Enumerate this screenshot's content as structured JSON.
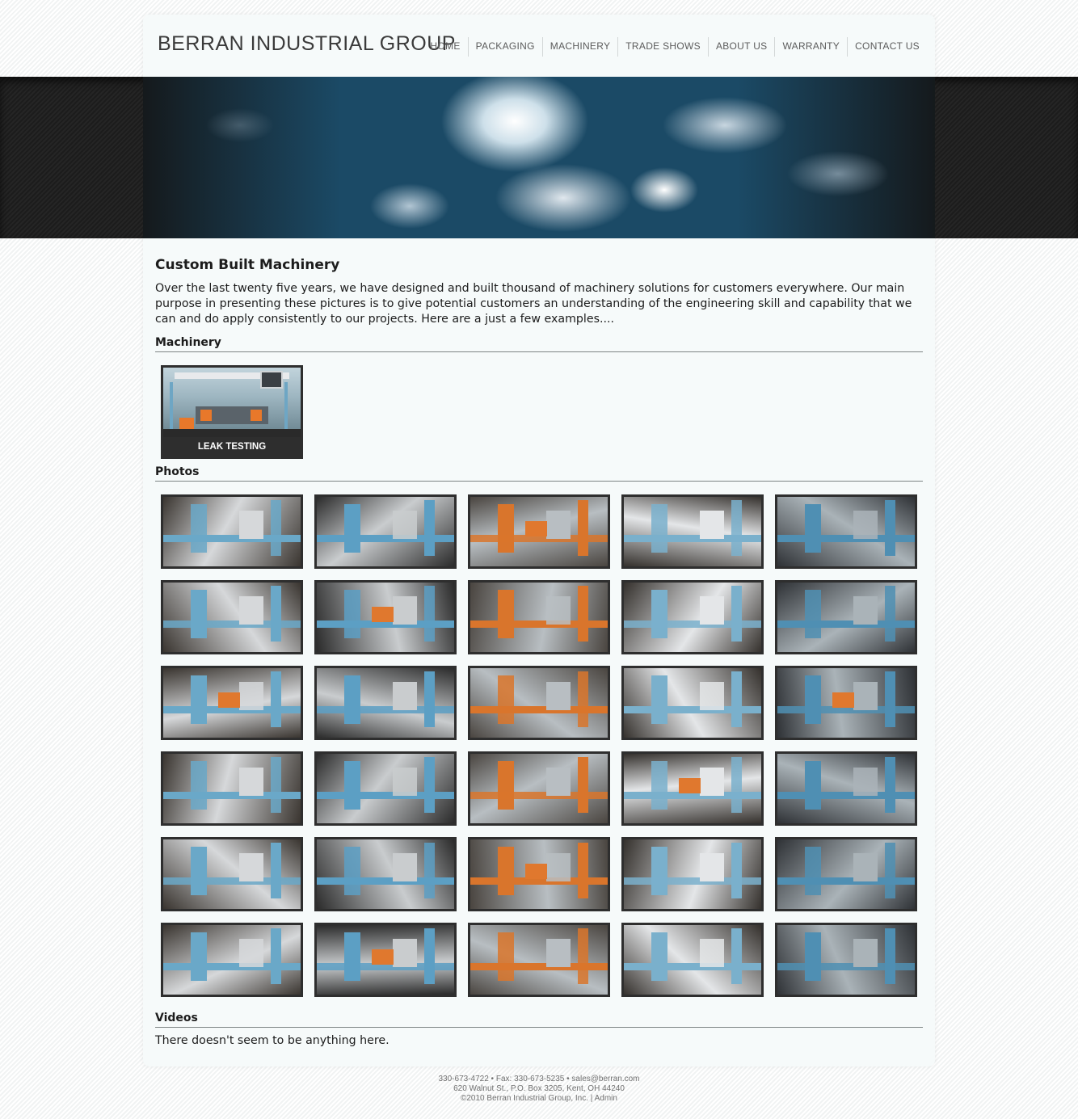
{
  "site": {
    "logo": "BERRAN INDUSTRIAL GROUP"
  },
  "nav": {
    "items": [
      {
        "label": "HOME"
      },
      {
        "label": "PACKAGING"
      },
      {
        "label": "MACHINERY"
      },
      {
        "label": "TRADE SHOWS"
      },
      {
        "label": "ABOUT US"
      },
      {
        "label": "WARRANTY"
      },
      {
        "label": "CONTACT US"
      }
    ]
  },
  "main": {
    "title": "Custom Built Machinery",
    "intro": "Over the last twenty five years, we have designed and built thousand of machinery solutions for customers everywhere. Our main purpose in presenting these pictures is to give potential customers an understanding of the engineering skill and capability that we can and do apply consistently to our projects. Here are a just a few examples....",
    "machinery_heading": "Machinery",
    "machinery_items": [
      {
        "label": "LEAK TESTING"
      }
    ],
    "photos_heading": "Photos",
    "photo_count": 30,
    "videos_heading": "Videos",
    "videos_empty": "There doesn't seem to be anything here."
  },
  "footer": {
    "phone": "330-673-4722",
    "sep1": " • Fax: ",
    "fax": "330-673-5235",
    "sep2": " • ",
    "email": "sales@berran.com",
    "address": "620 Walnut St., P.O. Box 3205, Kent, OH 44240",
    "copyright": "©2010 Berran Industrial Group, Inc.",
    "sep3": " | ",
    "admin": "Admin"
  }
}
